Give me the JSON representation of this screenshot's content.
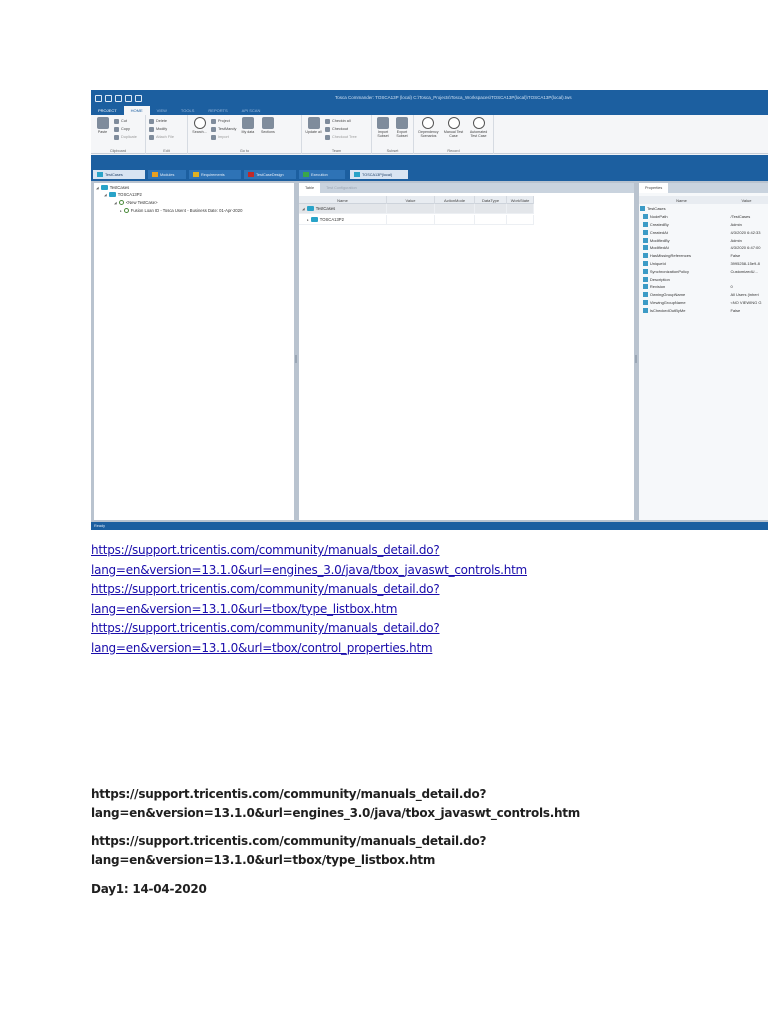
{
  "screenshot": {
    "window_title": "Tosca Commander: TOSCA13P (local) C:\\Tosca_Projects\\Tosca_Workspaces\\TOSCA13P(local)\\TOSCA13P(local).tws",
    "ribbon_tabs": [
      "PROJECT",
      "HOME",
      "VIEW",
      "TOOLS",
      "REPORTS",
      "API SCAN"
    ],
    "ribbon_groups": [
      {
        "label": "Clipboard",
        "big": [
          "Paste"
        ],
        "small": [
          "Cut",
          "Copy",
          "Duplicate"
        ]
      },
      {
        "label": "Edit",
        "small": [
          "Delete",
          "Modify",
          "Attach File"
        ]
      },
      {
        "label": "Go to",
        "big": [
          "Search..."
        ],
        "small": [
          "Project",
          "TestMandy",
          "Import"
        ],
        "extra": [
          "My data",
          "Sections"
        ]
      },
      {
        "label": "Team",
        "big": [
          "Update all"
        ],
        "small": [
          "Checkin all",
          "Checkout",
          "Checkout Tree"
        ]
      },
      {
        "label": "Subset",
        "big": [
          "Import Subset",
          "Export Subset"
        ]
      },
      {
        "label": "Record",
        "big": [
          "Dependency Scenarios",
          "Manual Test Case",
          "Automated Test Case"
        ]
      }
    ],
    "doc_tabs": [
      {
        "label": "TestCases",
        "color": "#29a3c8"
      },
      {
        "label": "Modules",
        "color": "#e8a020"
      },
      {
        "label": "Requirements",
        "color": "#e0b020"
      },
      {
        "label": "TestCaseDesign",
        "color": "#c02a2a"
      },
      {
        "label": "Execution",
        "color": "#3aa64a"
      },
      {
        "label": "TOSCA13P(local)",
        "color": "#29a3c8"
      }
    ],
    "tree": {
      "root": "TestCases",
      "child": "TOSCA13P2",
      "new_testcase": "<New TestCase>",
      "fusion_item": "Fusion Loan ID - Tosca User4 - Business Date: 01-Apr-2020"
    },
    "middle": {
      "tabs": [
        "Table",
        "Test Configuration"
      ],
      "columns": [
        "Name",
        "Value",
        "ActionMode",
        "DataType",
        "WorkState"
      ],
      "rows": [
        "TestCases",
        "TOSCA13P2"
      ]
    },
    "properties": {
      "tab": "Properties",
      "columns": [
        "Name",
        "Value"
      ],
      "rows": [
        {
          "name": "TestCases",
          "value": ""
        },
        {
          "name": "NodePath",
          "value": "/TestCases"
        },
        {
          "name": "CreatedBy",
          "value": "Admin"
        },
        {
          "name": "CreatedAt",
          "value": "4/3/2020 6:42:33"
        },
        {
          "name": "ModifiedBy",
          "value": "Admin"
        },
        {
          "name": "ModifiedAt",
          "value": "4/3/2020 6:47:00"
        },
        {
          "name": "HasMissingReferences",
          "value": "False"
        },
        {
          "name": "UniqueId",
          "value": "3995258-15e9-8"
        },
        {
          "name": "SynchronizationPolicy",
          "value": "CustomizedU..."
        },
        {
          "name": "Description",
          "value": ""
        },
        {
          "name": "Revision",
          "value": "0"
        },
        {
          "name": "OwningGroupName",
          "value": "All Users (inheri"
        },
        {
          "name": "ViewingGroupName",
          "value": "<NO VIEWING G"
        },
        {
          "name": "IsCheckedOutByMe",
          "value": "False"
        }
      ]
    },
    "status": "Ready"
  },
  "links": [
    [
      "https://support.tricentis.com/community/manuals_detail.do?",
      "lang=en&version=13.1.0&url=engines_3.0/java/tbox_javaswt_controls.htm"
    ],
    [
      "https://support.tricentis.com/community/manuals_detail.do?",
      "lang=en&version=13.1.0&url=tbox/type_listbox.htm"
    ],
    [
      "https://support.tricentis.com/community/manuals_detail.do?",
      "lang=en&version=13.1.0&url=tbox/control_properties.htm"
    ]
  ],
  "plain_links": [
    [
      "https://support.tricentis.com/community/manuals_detail.do?",
      "lang=en&version=13.1.0&url=engines_3.0/java/tbox_javaswt_controls.htm"
    ],
    [
      "https://support.tricentis.com/community/manuals_detail.do?",
      "lang=en&version=13.1.0&url=tbox/type_listbox.htm"
    ]
  ],
  "day_note": "Day1: 14-04-2020"
}
